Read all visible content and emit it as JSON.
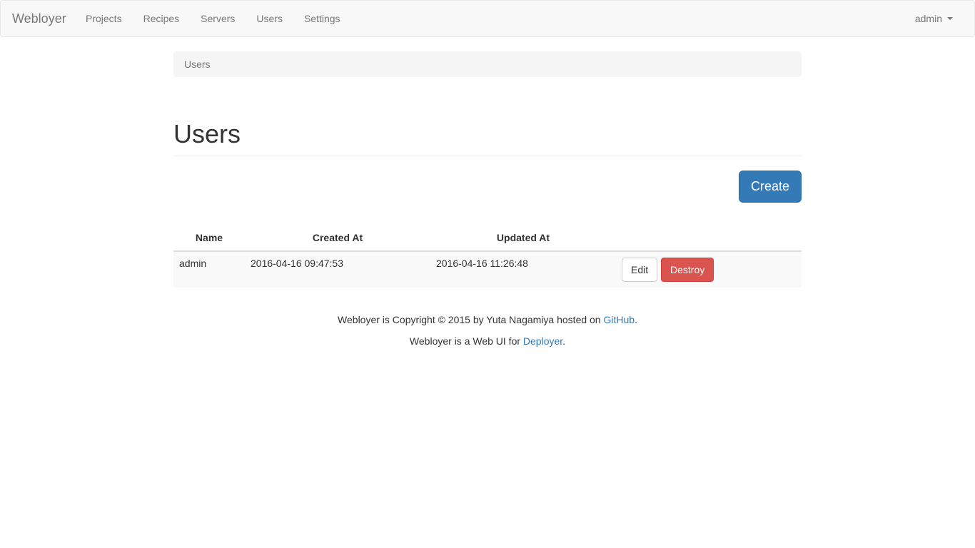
{
  "navbar": {
    "brand": "Webloyer",
    "links": [
      {
        "label": "Projects"
      },
      {
        "label": "Recipes"
      },
      {
        "label": "Servers"
      },
      {
        "label": "Users"
      },
      {
        "label": "Settings"
      }
    ],
    "user_menu": "admin"
  },
  "breadcrumb": {
    "current": "Users"
  },
  "page": {
    "title": "Users",
    "create_label": "Create"
  },
  "table": {
    "headers": {
      "name": "Name",
      "created_at": "Created At",
      "updated_at": "Updated At"
    },
    "rows": [
      {
        "name": "admin",
        "created_at": "2016-04-16 09:47:53",
        "updated_at": "2016-04-16 11:26:48",
        "edit_label": "Edit",
        "destroy_label": "Destroy"
      }
    ]
  },
  "footer": {
    "line1_prefix": "Webloyer is Copyright © 2015 by Yuta Nagamiya hosted on ",
    "line1_link": "GitHub",
    "line1_suffix": ".",
    "line2_prefix": "Webloyer is a Web UI for ",
    "line2_link": "Deployer",
    "line2_suffix": "."
  },
  "colors": {
    "primary": "#337ab7",
    "danger": "#d9534f",
    "navbar_bg": "#f8f8f8"
  }
}
